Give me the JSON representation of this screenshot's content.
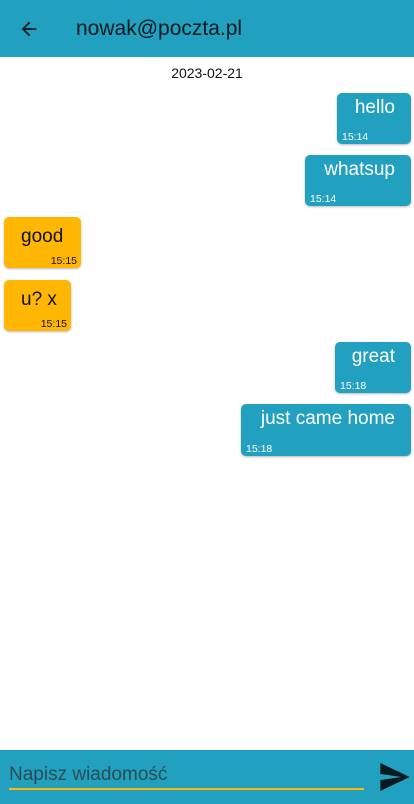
{
  "header": {
    "title": "nowak@poczta.pl",
    "back_icon": "arrow-left-icon"
  },
  "date_separator": "2023-02-21",
  "messages": [
    {
      "text": "hello",
      "time": "15:14",
      "direction": "outgoing"
    },
    {
      "text": "whatsup",
      "time": "15:14",
      "direction": "outgoing"
    },
    {
      "text": "good",
      "time": "15:15",
      "direction": "incoming"
    },
    {
      "text": "u? x",
      "time": "15:15",
      "direction": "incoming"
    },
    {
      "text": "great",
      "time": "15:18",
      "direction": "outgoing"
    },
    {
      "text": "just came home",
      "time": "15:18",
      "direction": "outgoing"
    }
  ],
  "composer": {
    "placeholder": "Napisz wiadomość",
    "value": "",
    "send_icon": "send-icon"
  },
  "colors": {
    "primary": "#22a0bf",
    "accent": "#ffb703",
    "background": "#ffffff"
  }
}
